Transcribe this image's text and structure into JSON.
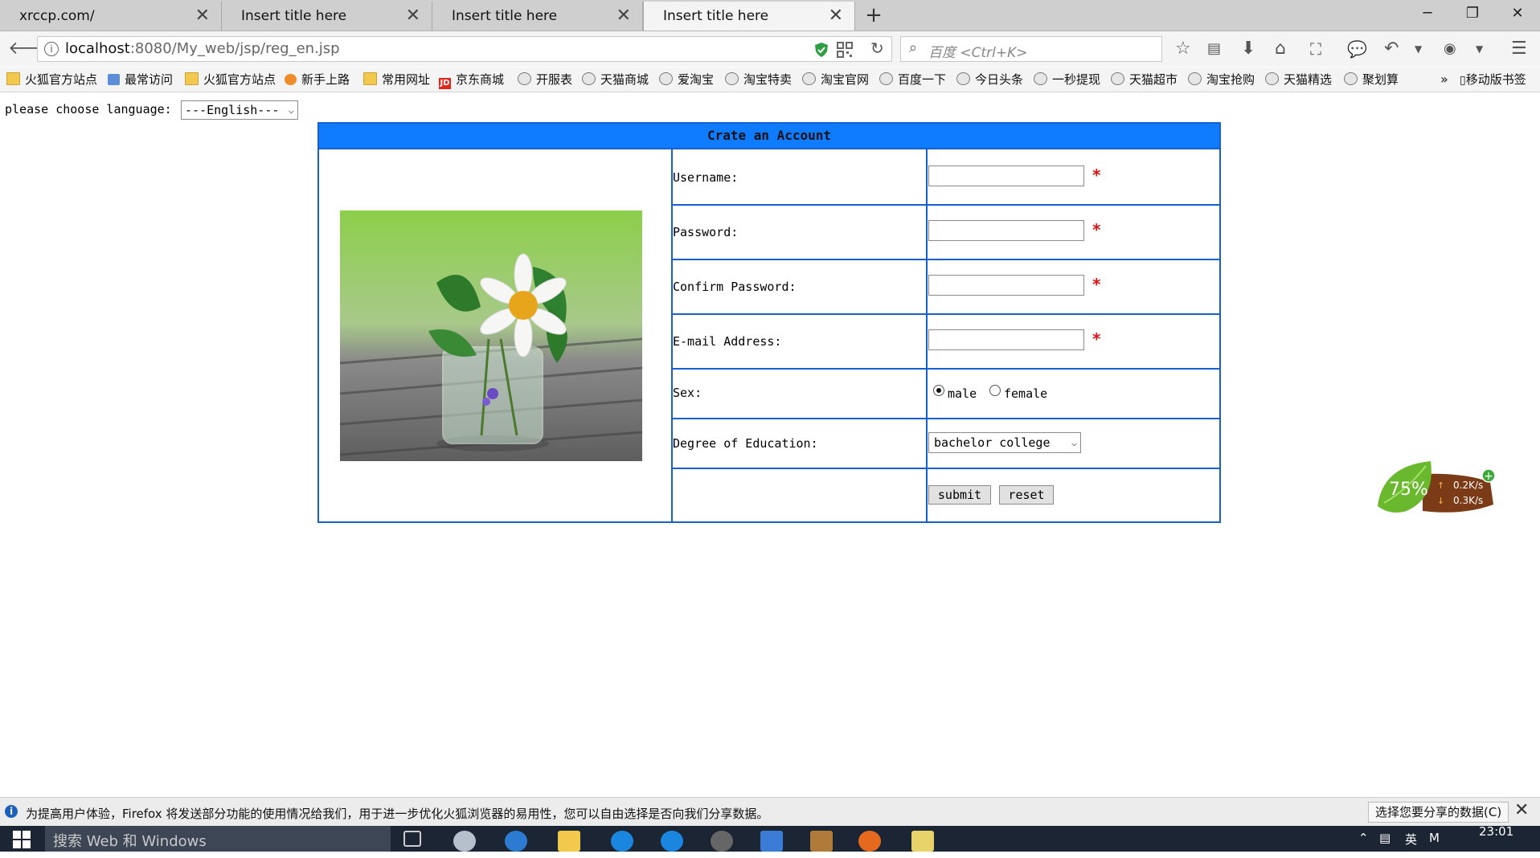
{
  "browser": {
    "tabs": [
      {
        "title": "xrccp.com/"
      },
      {
        "title": "Insert title here"
      },
      {
        "title": "Insert title here"
      },
      {
        "title": "Insert title here",
        "active": true
      }
    ],
    "url_host": "localhost",
    "url_path": ":8080/My_web/jsp/reg_en.jsp",
    "search_placeholder": "百度 <Ctrl+K>",
    "bookmarks": [
      {
        "label": "火狐官方站点",
        "icon": "folder-icon"
      },
      {
        "label": "最常访问",
        "icon": "most-visited-icon"
      },
      {
        "label": "火狐官方站点",
        "icon": "folder-icon"
      },
      {
        "label": "新手上路",
        "icon": "firefox-icon"
      },
      {
        "label": "常用网址",
        "icon": "folder-icon"
      },
      {
        "label": "京东商城",
        "icon": "jd-icon"
      },
      {
        "label": "开服表",
        "icon": "globe-icon"
      },
      {
        "label": "天猫商城",
        "icon": "globe-icon"
      },
      {
        "label": "爱淘宝",
        "icon": "globe-icon"
      },
      {
        "label": "淘宝特卖",
        "icon": "globe-icon"
      },
      {
        "label": "淘宝官网",
        "icon": "globe-icon"
      },
      {
        "label": "百度一下",
        "icon": "globe-icon"
      },
      {
        "label": "今日头条",
        "icon": "globe-icon"
      },
      {
        "label": "一秒提现",
        "icon": "globe-icon"
      },
      {
        "label": "天猫超市",
        "icon": "globe-icon"
      },
      {
        "label": "淘宝抢购",
        "icon": "globe-icon"
      },
      {
        "label": "天猫精选",
        "icon": "globe-icon"
      },
      {
        "label": "聚划算",
        "icon": "globe-icon"
      }
    ],
    "mobile_bookmarks": "移动版书签"
  },
  "page": {
    "language_prompt": "please choose language:",
    "language_selected": "---English---",
    "form_title": "Crate an Account",
    "labels": {
      "username": "Username:",
      "password": "Password:",
      "confirm_password": "Confirm Password:",
      "email": "E-mail Address:",
      "sex": "Sex:",
      "education": "Degree of Education:"
    },
    "required_mark": "*",
    "sex_options": [
      "male",
      "female"
    ],
    "sex_selected": "male",
    "education_selected": "bachelor college",
    "submit_label": "submit",
    "reset_label": "reset"
  },
  "speed_widget": {
    "percent": "75%",
    "upload": "0.2K/s",
    "download": "0.3K/s"
  },
  "notification": {
    "text": "为提高用户体验，Firefox 将发送部分功能的使用情况给我们，用于进一步优化火狐浏览器的易用性，您可以自由选择是否向我们分享数据。",
    "button": "选择您要分享的数据(C)"
  },
  "taskbar": {
    "search_placeholder": "搜索 Web 和 Windows",
    "time": "23:01",
    "ime": "英"
  },
  "colors": {
    "form_header": "#0f7bff",
    "form_border": "#1560d4",
    "required": "#e01010"
  }
}
